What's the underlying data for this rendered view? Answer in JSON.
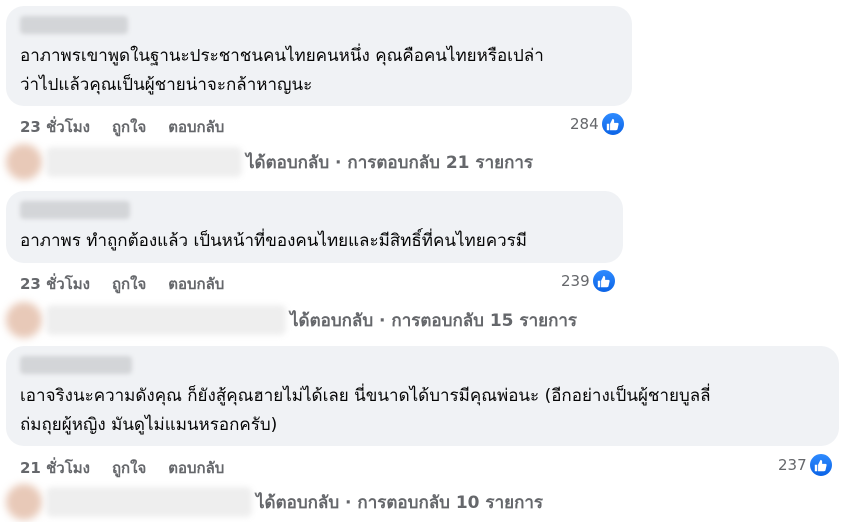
{
  "comments": [
    {
      "text": "อาภาพรเขาพูดในฐานะประชาชนคนไทยคนหนึ่ง คุณคือคนไทยหรือเปล่า\nว่าไปแล้วคุณเป็นผู้ชายน่าจะกล้าหาญนะ",
      "time": "23 ชั่วโมง",
      "like_label": "ถูกใจ",
      "reply_label": "ตอบกลับ",
      "reaction_count": "284",
      "replies_text": "ได้ตอบกลับ · การตอบกลับ 21 รายการ"
    },
    {
      "text": "อาภาพร ทำถูกต้องแล้ว เป็นหน้าที่ของคนไทยและมีสิทธิ์ที่คนไทยควรมี",
      "time": "23 ชั่วโมง",
      "like_label": "ถูกใจ",
      "reply_label": "ตอบกลับ",
      "reaction_count": "239",
      "replies_text": "ได้ตอบกลับ · การตอบกลับ 15 รายการ"
    },
    {
      "text": "เอาจริงนะความดังคุณ ก็ยังสู้คุณฮายไม่ได้เลย นี่ขนาดได้บารมีคุณพ่อนะ (อีกอย่างเป็นผู้ชายบูลลี่\nถ่มถุยผู้หญิง มันดูไม่แมนหรอกครับ)",
      "time": "21 ชั่วโมง",
      "like_label": "ถูกใจ",
      "reply_label": "ตอบกลับ",
      "reaction_count": "237",
      "replies_text": "ได้ตอบกลับ · การตอบกลับ 10 รายการ"
    }
  ],
  "colors": {
    "bubble": "#f0f2f5",
    "meta": "#65676b",
    "like_blue": "#1877f2"
  },
  "icons": {
    "reaction": "like-thumb-icon"
  }
}
